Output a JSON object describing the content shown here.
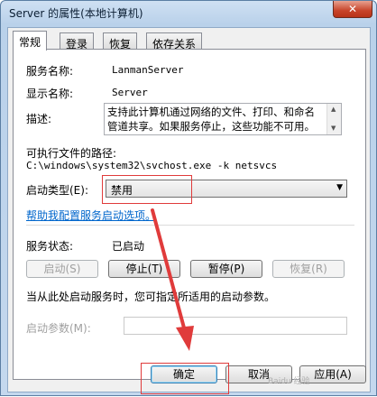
{
  "window": {
    "title": "Server 的属性(本地计算机)",
    "close_glyph": "✕"
  },
  "tabs": [
    {
      "label": "常规",
      "active": true
    },
    {
      "label": "登录",
      "active": false
    },
    {
      "label": "恢复",
      "active": false
    },
    {
      "label": "依存关系",
      "active": false
    }
  ],
  "general": {
    "service_name_label": "服务名称:",
    "service_name_value": "LanmanServer",
    "display_name_label": "显示名称:",
    "display_name_value": "Server",
    "description_label": "描述:",
    "description_value": "支持此计算机通过网络的文件、打印、和命名管道共享。如果服务停止，这些功能不可用。",
    "exe_path_label": "可执行文件的路径:",
    "exe_path_value": "C:\\windows\\system32\\svchost.exe -k netsvcs",
    "startup_type_label": "启动类型(E):",
    "startup_type_value": "禁用",
    "help_link": "帮助我配置服务启动选项。",
    "status_label": "服务状态:",
    "status_value": "已启动",
    "start_button": "启动(S)",
    "stop_button": "停止(T)",
    "pause_button": "暂停(P)",
    "resume_button": "恢复(R)",
    "hint_text": "当从此处启动服务时，您可指定所适用的启动参数。",
    "start_params_label": "启动参数(M):",
    "start_params_value": ""
  },
  "footer": {
    "ok_button": "确定",
    "cancel_button": "取消",
    "apply_button": "应用(A)"
  },
  "annotation_color": "#e03b3b",
  "watermark": "Baidu 经验"
}
